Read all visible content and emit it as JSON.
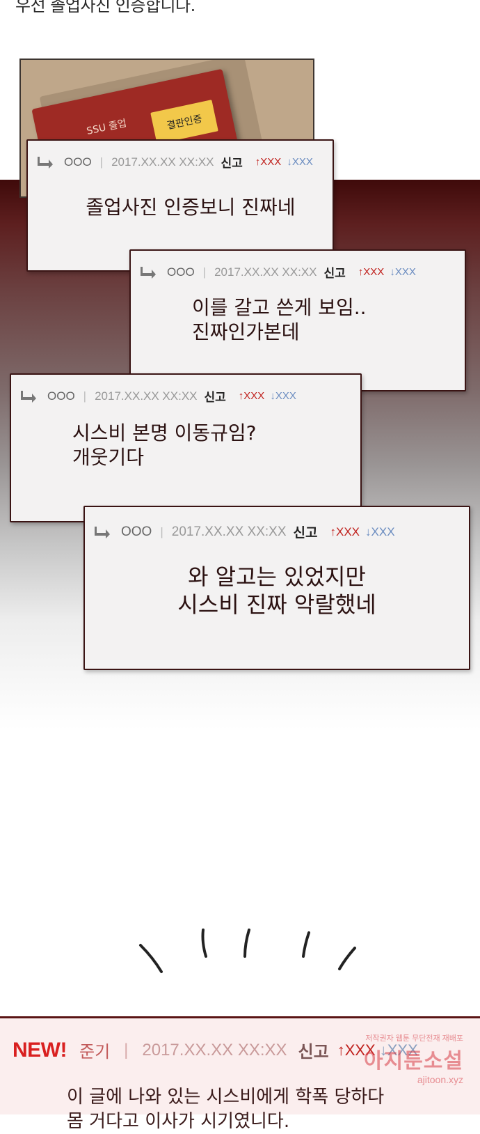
{
  "intro_text": "우선 졸업사진 인증합니다.",
  "photo": {
    "book_label": "결판인증",
    "book_script": "SSU 졸업"
  },
  "comments": [
    {
      "user": "OOO",
      "date": "2017.XX.XX XX:XX",
      "report": "신고",
      "up": "↑XXX",
      "down": "↓XXX",
      "lines": [
        "졸업사진 인증보니 진짜네"
      ]
    },
    {
      "user": "OOO",
      "date": "2017.XX.XX XX:XX",
      "report": "신고",
      "up": "↑XXX",
      "down": "↓XXX",
      "lines": [
        "이를 갈고 쓴게 보임..",
        "진짜인가본데"
      ]
    },
    {
      "user": "OOO",
      "date": "2017.XX.XX XX:XX",
      "report": "신고",
      "up": "↑XXX",
      "down": "↓XXX",
      "lines": [
        "시스비 본명 이동규임?",
        "개웃기다"
      ]
    },
    {
      "user": "OOO",
      "date": "2017.XX.XX XX:XX",
      "report": "신고",
      "up": "↑XXX",
      "down": "↓XXX",
      "lines": [
        "와 알고는 있었지만",
        "시스비 진짜 악랄했네"
      ]
    }
  ],
  "new_comment": {
    "badge": "NEW!",
    "user": "준기",
    "separator": "|",
    "date": "2017.XX.XX XX:XX",
    "report": "신고",
    "up": "↑XXX",
    "down": "↓XXX",
    "lines": [
      "이 글에 나와 있는 시스비에게 학폭 당하다",
      "몸 거다고 이사가 시기였니다."
    ]
  },
  "watermark": {
    "small": "저작권자 웹툰 무단전재 재배포",
    "big": "아지툰소설",
    "url": "ajitoon.xyz"
  },
  "colors": {
    "accent": "#d92020",
    "card_border": "#3a1414",
    "up": "#c0221e",
    "down": "#6a8cc0"
  }
}
